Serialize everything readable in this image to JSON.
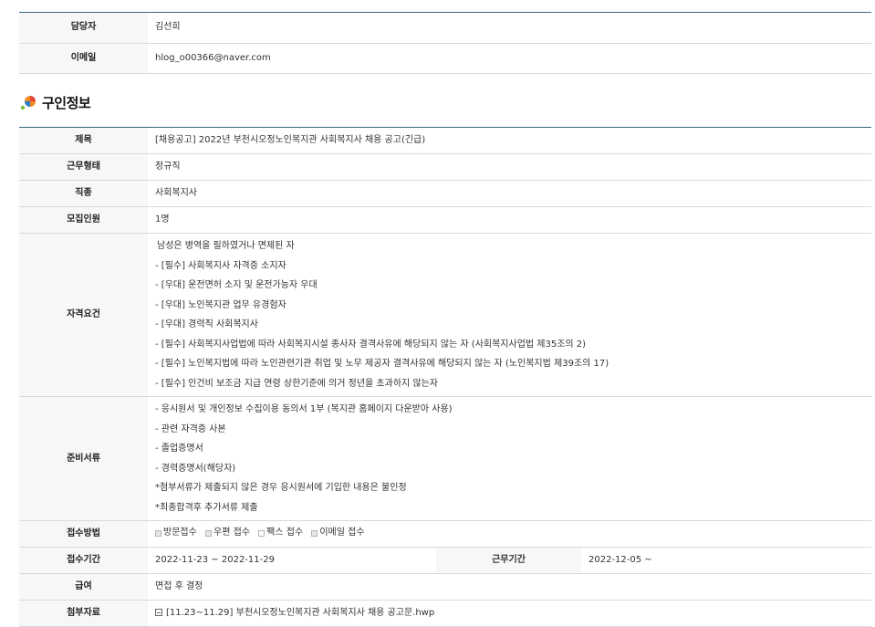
{
  "contact": {
    "manager_label": "담당자",
    "manager_value": "김선희",
    "email_label": "이메일",
    "email_value": "hlog_o00366@naver.com"
  },
  "section": {
    "title": "구인정보"
  },
  "job": {
    "title_label": "제목",
    "title_value": "[채용공고] 2022년 부천시오정노인복지관 사회복지사 채용 공고(긴급)",
    "worktype_label": "근무형태",
    "worktype_value": "정규직",
    "job_label": "직종",
    "job_value": "사회복지사",
    "headcount_label": "모집인원",
    "headcount_value": "1명",
    "qual_label": "자격요건",
    "qual_lines": [
      "남성은 병역을 필하였거나 면제된 자",
      "- [필수] 사회복지사 자격증 소지자",
      "- [우대] 운전면허 소지 및 운전가능자 우대",
      "- [우대] 노인복지관 업무 유경험자",
      "- [우대] 경력직 사회복지사",
      "- [필수] 사회복지사업법에 따라 사회복지시설 종사자 결격사유에 해당되지 않는 자 (사회복지사업법 제35조의 2)",
      "- [필수] 노인복지법에 따라 노인관련기관 취업 및 노무 제공자 결격사유에 해당되지 않는 자 (노인복지법 제39조의 17)",
      "- [필수] 인건비 보조금 지급 연령 상한기준에 의거 정년을 초과하지 않는자"
    ],
    "docs_label": "준비서류",
    "docs_lines": [
      "- 응시원서 및 개인정보 수집이용 동의서 1부 (복지관 홈페이지 다운받아 사용)",
      "- 관련 자격증 사본",
      "- 졸업증명서",
      "- 경력증명서(해당자)",
      "*첨부서류가 제출되지 않은 경우 응시원서에 기입한 내용은 불인정",
      "*최종합격후 추가서류 제출"
    ],
    "method_label": "접수방법",
    "methods": [
      {
        "label": "방문접수",
        "checked": true
      },
      {
        "label": "우편 접수",
        "checked": true
      },
      {
        "label": "팩스 접수",
        "checked": false
      },
      {
        "label": "이메일 접수",
        "checked": true
      }
    ],
    "period_label": "접수기간",
    "period_value": "2022-11-23 ~ 2022-11-29",
    "work_period_label": "근무기간",
    "work_period_value": "2022-12-05 ~",
    "salary_label": "급여",
    "salary_value": "면접 후 결정",
    "attach_label": "첨부자료",
    "attach_value": "[11.23~11.29] 부천시오정노인복지관 사회복지사 채용 공고문.hwp"
  }
}
